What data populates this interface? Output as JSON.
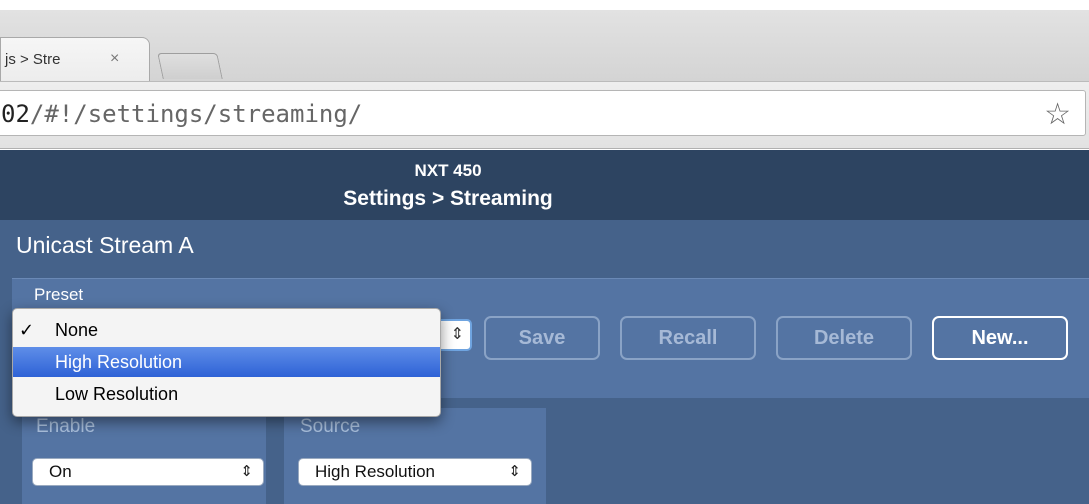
{
  "browser": {
    "tab_title": "js > Stre",
    "tab_close_glyph": "×",
    "url_host": "02",
    "url_path": "/#!/settings/streaming/",
    "bookmark_star": "☆"
  },
  "header": {
    "device": "NXT 450",
    "breadcrumb": "Settings > Streaming"
  },
  "stream": {
    "title": "Unicast Stream A",
    "preset_label": "Preset",
    "preset_options": [
      "None",
      "High Resolution",
      "Low Resolution"
    ],
    "preset_selected": "None",
    "preset_highlighted": "High Resolution",
    "checkmark": "✓",
    "select_arrows": "⇕",
    "buttons": {
      "save": "Save",
      "recall": "Recall",
      "delete": "Delete",
      "new": "New..."
    },
    "enable_label": "Enable",
    "enable_value": "On",
    "source_label": "Source",
    "source_value": "High Resolution"
  },
  "colors": {
    "app_background": "#45628a",
    "header_background": "#2d4461",
    "panel": "#5474a3",
    "highlight": "#2e62d6"
  }
}
